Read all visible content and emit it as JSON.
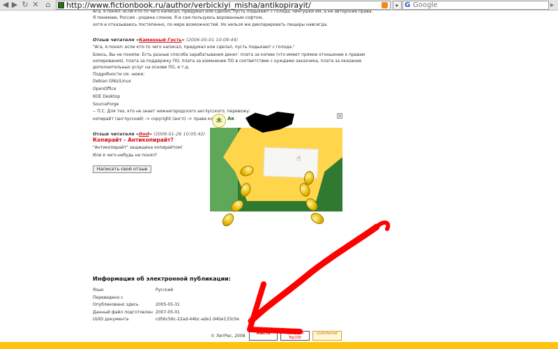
{
  "browser": {
    "url": "http://www.fictionbook.ru/author/verbickiyi_misha/antikopirayit/",
    "search_placeholder": "Google",
    "search_engine": "G",
    "nav_icons": [
      "back-icon",
      "forward-icon",
      "reload-icon",
      "stop-icon",
      "home-icon"
    ]
  },
  "comments": {
    "top_lines": [
      "Ага, я понял: если кто-то чего написал, придумал или сделал, пусть подыхают с голода, чингушки им, а не авторские права.",
      "Я понимаю, Россия - родина слонов. Я и сам пользуюсь ворованным софтом,",
      "хотя и отказываюсь постепенно, по мере возможностей. Но нельзя же декларировать пещеры навсегда."
    ],
    "c1": {
      "prefix": "Отзыв читателя «",
      "author": "Каменный Гость",
      "suffix": "»",
      "date": "(2006-05-01 10:09:44)",
      "quote": "\"Ага, я понял: если кто-то чего написал, придумал или сделал, пусть подыхают с голода.\"",
      "body1": "Боюсь, Вы не поняли. Есть разные способа зарабатывания денег: плата за копию (что имеет прямое отношение к правам",
      "body2": "копирования), плата за поддержку ПО, плата за изменение ПО в соответствие с нуждами заказчика, плата за оказание",
      "body3": "дополнительных услуг на основе ПО, и т.д.",
      "details": "Подробности см. ниже:",
      "items": [
        "Debian GNU/Linux",
        "OpenOffice",
        "KDE Desktop",
        "SourceForge"
      ],
      "ps": "-- П.С. Для тех, кто не знает нижнегородского англусского, перевожу:",
      "translation": "копирайт (англусский) -> copyright (англ) -> права ко"
    },
    "c2": {
      "prefix": "Отзыв читателя «",
      "author": "Dod",
      "suffix": "»",
      "date": "(2009-01-26 10:05:42)",
      "title": "Копирайт - Антикопирайт?",
      "line1": "\"Антикопирайт\" защищена копирайтом!",
      "line2": "Или я чего-нибудь не понял?"
    },
    "write_button": "Написать свой отзыв"
  },
  "ad": {
    "logo_glyph": "木",
    "logo_text": "Ак",
    "close": "×"
  },
  "publication_info": {
    "title": "Информация об электронной публикации:",
    "rows": [
      {
        "key": "Язык",
        "value": "Русский"
      },
      {
        "key": "Переведено с",
        "value": ""
      },
      {
        "key": "Опубликовано здесь",
        "value": "2005-05-31"
      },
      {
        "key": "Данный файл подготовлен",
        "value": "2007-05-01"
      },
      {
        "key": "UUID документа",
        "value": "cd56c56c-22ad-44bc-ade1-94be133c0e"
      }
    ]
  },
  "footer": {
    "copyright": "© ЛитРес, 2008",
    "badges": [
      "Mail.ru",
      "Rambler's Top100",
      "LiveInternet"
    ]
  },
  "colors": {
    "accent_red": "#d4101a",
    "bar_yellow": "#ffc20e",
    "arrow_red": "#ff0000"
  }
}
